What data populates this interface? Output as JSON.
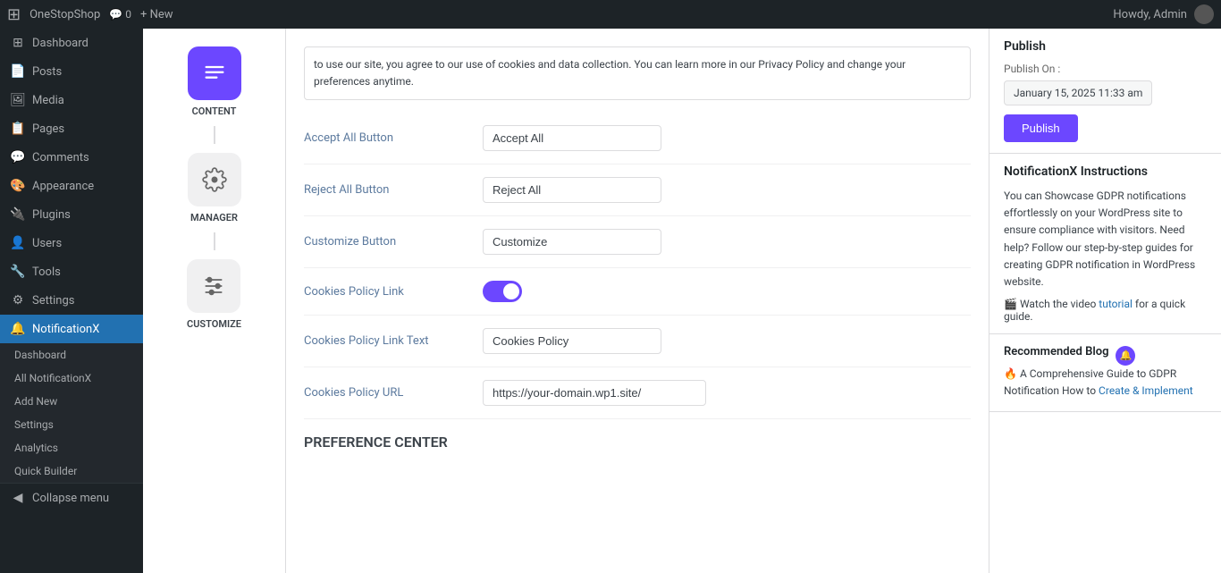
{
  "topbar": {
    "wp_icon": "⊞",
    "site_name": "OneStopShop",
    "comment_icon": "💬",
    "comment_count": "0",
    "new_label": "+ New",
    "howdy": "Howdy, Admin"
  },
  "sidebar": {
    "items": [
      {
        "id": "dashboard",
        "label": "Dashboard",
        "icon": "⊞"
      },
      {
        "id": "posts",
        "label": "Posts",
        "icon": "📄"
      },
      {
        "id": "media",
        "label": "Media",
        "icon": "🖼"
      },
      {
        "id": "pages",
        "label": "Pages",
        "icon": "📋"
      },
      {
        "id": "comments",
        "label": "Comments",
        "icon": "💬"
      },
      {
        "id": "appearance",
        "label": "Appearance",
        "icon": "🎨"
      },
      {
        "id": "plugins",
        "label": "Plugins",
        "icon": "🔌"
      },
      {
        "id": "users",
        "label": "Users",
        "icon": "👤"
      },
      {
        "id": "tools",
        "label": "Tools",
        "icon": "🔧"
      },
      {
        "id": "settings",
        "label": "Settings",
        "icon": "⚙"
      },
      {
        "id": "notificationx",
        "label": "NotificationX",
        "icon": "🔔"
      }
    ],
    "submenu": [
      {
        "id": "nx-dashboard",
        "label": "Dashboard"
      },
      {
        "id": "nx-all",
        "label": "All NotificationX"
      },
      {
        "id": "nx-add",
        "label": "Add New"
      },
      {
        "id": "nx-settings",
        "label": "Settings"
      },
      {
        "id": "nx-analytics",
        "label": "Analytics"
      },
      {
        "id": "nx-quick",
        "label": "Quick Builder"
      }
    ],
    "collapse_label": "Collapse menu"
  },
  "wizard": {
    "steps": [
      {
        "id": "content",
        "label": "CONTENT",
        "icon": "📄",
        "active": true
      },
      {
        "id": "manager",
        "label": "MANAGER",
        "icon": "⚙",
        "active": false
      },
      {
        "id": "customize",
        "label": "CUSTOMIZE",
        "icon": "⚙",
        "active": false
      }
    ]
  },
  "cookie_notice": {
    "text": "to use our site, you agree to our use of cookies and data collection. You can learn more in our Privacy Policy and change your preferences anytime."
  },
  "form": {
    "accept_all_button_label": "Accept All Button",
    "accept_all_button_value": "Accept All",
    "reject_all_button_label": "Reject All Button",
    "reject_all_button_value": "Reject All",
    "customize_button_label": "Customize Button",
    "customize_button_value": "Customize",
    "cookies_policy_link_label": "Cookies Policy Link",
    "cookies_policy_link_text_label": "Cookies Policy Link Text",
    "cookies_policy_link_text_value": "Cookies Policy",
    "cookies_policy_url_label": "Cookies Policy URL",
    "cookies_policy_url_value": "https://your-domain.wp1.site/",
    "preference_center_label": "PREFERENCE CENTER"
  },
  "publish_panel": {
    "title": "Publish",
    "publish_on_label": "Publish On :",
    "publish_date": "January 15, 2025 11:33 am",
    "publish_button_label": "Publish"
  },
  "instructions_panel": {
    "title": "NotificationX Instructions",
    "text": "You can Showcase GDPR notifications effortlessly on your WordPress site to ensure compliance with visitors. Need help? Follow our step-by-step guides for creating GDPR notification in WordPress website.",
    "watch_label": "Watch the video ",
    "tutorial_label": "tutorial",
    "quick_label": " for a quick guide."
  },
  "recommended_panel": {
    "title": "Recommended Blog",
    "fire_icon": "🔥",
    "blog_title": "A Comprehensive Guide to GDPR Notification How to",
    "create_label": "Create & Implement"
  }
}
